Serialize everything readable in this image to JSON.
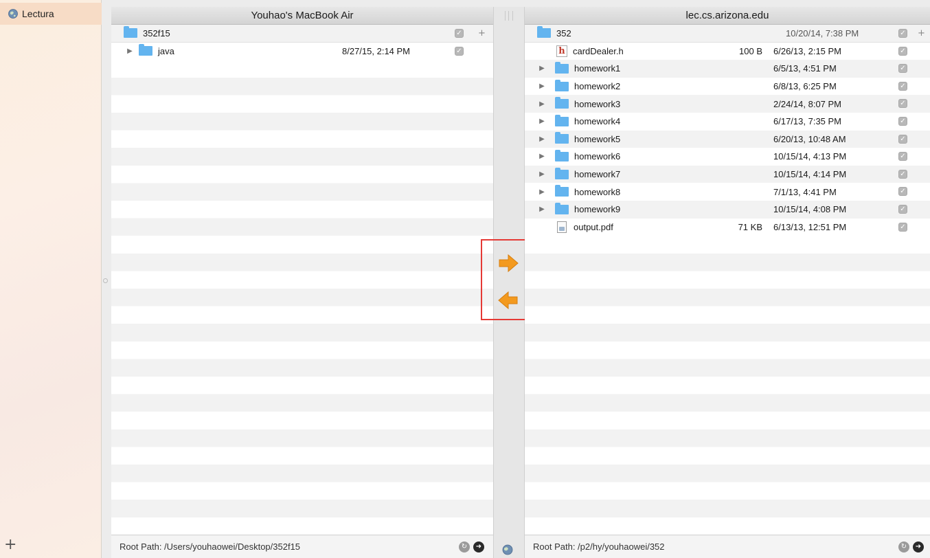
{
  "sidebar": {
    "items": [
      {
        "label": "Lectura",
        "icon": "globe-icon"
      }
    ],
    "add_label": "+"
  },
  "left_pane": {
    "title": "Youhao's MacBook Air",
    "root": {
      "name": "352f15",
      "checked": true
    },
    "items": [
      {
        "name": "java",
        "type": "folder",
        "size": "",
        "date": "8/27/15, 2:14 PM",
        "checked": true
      }
    ],
    "root_path": "Root Path: /Users/youhaowei/Desktop/352f15"
  },
  "right_pane": {
    "title": "lec.cs.arizona.edu",
    "root": {
      "name": "352",
      "date": "10/20/14, 7:38 PM",
      "checked": true
    },
    "items": [
      {
        "name": "cardDealer.h",
        "type": "h-file",
        "size": "100 B",
        "date": "6/26/13, 2:15 PM",
        "checked": true
      },
      {
        "name": "homework1",
        "type": "folder",
        "size": "",
        "date": "6/5/13, 4:51 PM",
        "checked": true
      },
      {
        "name": "homework2",
        "type": "folder",
        "size": "",
        "date": "6/8/13, 6:25 PM",
        "checked": true
      },
      {
        "name": "homework3",
        "type": "folder",
        "size": "",
        "date": "2/24/14, 8:07 PM",
        "checked": true
      },
      {
        "name": "homework4",
        "type": "folder",
        "size": "",
        "date": "6/17/13, 7:35 PM",
        "checked": true
      },
      {
        "name": "homework5",
        "type": "folder",
        "size": "",
        "date": "6/20/13, 10:48 AM",
        "checked": true
      },
      {
        "name": "homework6",
        "type": "folder",
        "size": "",
        "date": "10/15/14, 4:13 PM",
        "checked": true
      },
      {
        "name": "homework7",
        "type": "folder",
        "size": "",
        "date": "10/15/14, 4:14 PM",
        "checked": true
      },
      {
        "name": "homework8",
        "type": "folder",
        "size": "",
        "date": "7/1/13, 4:41 PM",
        "checked": true
      },
      {
        "name": "homework9",
        "type": "folder",
        "size": "",
        "date": "10/15/14, 4:08 PM",
        "checked": true
      },
      {
        "name": "output.pdf",
        "type": "pdf-file",
        "size": "71 KB",
        "date": "6/13/13, 12:51 PM",
        "checked": true
      }
    ],
    "root_path": "Root Path: /p2/hy/youhaowei/352"
  },
  "transfer": {
    "upload_icon": "arrow-right-icon",
    "download_icon": "arrow-left-icon",
    "arrow_color": "#f39a1f",
    "highlight_color": "#e53935"
  },
  "colors": {
    "folder": "#63b4ef",
    "sidebar_selected": "#f7dcc6"
  }
}
